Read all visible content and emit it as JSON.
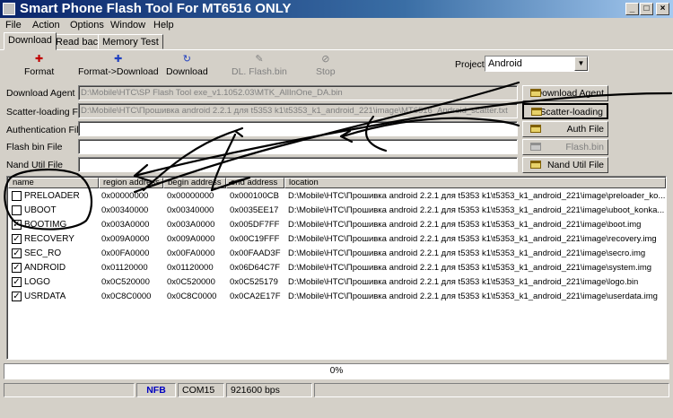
{
  "window": {
    "title": "Smart Phone Flash Tool For MT6516 ONLY",
    "minimize": "_",
    "maximize": "□",
    "close": "×"
  },
  "menu": [
    "File",
    "Action",
    "Options",
    "Window",
    "Help"
  ],
  "tabs": [
    "Download",
    "Read back",
    "Memory Test"
  ],
  "toolbar": {
    "format": "Format",
    "format_download": "Format->Download",
    "download": "Download",
    "dl_flash_bin": "DL. Flash.bin",
    "stop": "Stop"
  },
  "project": {
    "label": "Project",
    "value": "Android"
  },
  "fields": {
    "download_agent": {
      "label": "Download Agent",
      "value": "D:\\Mobile\\HTC\\SP Flash Tool exe_v1.1052.03\\MTK_AllInOne_DA.bin"
    },
    "scatter_loading": {
      "label": "Scatter-loading File",
      "value": "D:\\Mobile\\HTC\\Прошивка android 2.2.1 для t5353 k1\\t5353_k1_android_221\\image\\MT6516_Android_scatter.txt"
    },
    "authentication": {
      "label": "Authentication File",
      "value": ""
    },
    "flash_bin": {
      "label": "Flash bin File",
      "value": ""
    },
    "nand_util": {
      "label": "Nand Util File",
      "value": ""
    }
  },
  "buttons": {
    "download_agent": "Download Agent",
    "scatter_loading": "Scatter-loading",
    "auth_file": "Auth File",
    "flash_bin": "Flash.bin",
    "nand_util_file": "Nand Util File"
  },
  "list": {
    "headers": [
      "name",
      "region address",
      "begin address",
      "end address",
      "location"
    ],
    "rows": [
      {
        "checked": false,
        "name": "PRELOADER",
        "region": "0x00000000",
        "begin": "0x00000000",
        "end": "0x000100CB",
        "location": "D:\\Mobile\\HTC\\Прошивка android 2.2.1 для t5353 k1\\t5353_k1_android_221\\image\\preloader_ko..."
      },
      {
        "checked": false,
        "name": "UBOOT",
        "region": "0x00340000",
        "begin": "0x00340000",
        "end": "0x0035EE17",
        "location": "D:\\Mobile\\HTC\\Прошивка android 2.2.1 для t5353 k1\\t5353_k1_android_221\\image\\uboot_konka..."
      },
      {
        "checked": true,
        "name": "BOOTIMG",
        "region": "0x003A0000",
        "begin": "0x003A0000",
        "end": "0x005DF7FF",
        "location": "D:\\Mobile\\HTC\\Прошивка android 2.2.1 для t5353 k1\\t5353_k1_android_221\\image\\boot.img"
      },
      {
        "checked": true,
        "name": "RECOVERY",
        "region": "0x009A0000",
        "begin": "0x009A0000",
        "end": "0x00C19FFF",
        "location": "D:\\Mobile\\HTC\\Прошивка android 2.2.1 для t5353 k1\\t5353_k1_android_221\\image\\recovery.img"
      },
      {
        "checked": true,
        "name": "SEC_RO",
        "region": "0x00FA0000",
        "begin": "0x00FA0000",
        "end": "0x00FAAD3F",
        "location": "D:\\Mobile\\HTC\\Прошивка android 2.2.1 для t5353 k1\\t5353_k1_android_221\\image\\secro.img"
      },
      {
        "checked": true,
        "name": "ANDROID",
        "region": "0x01120000",
        "begin": "0x01120000",
        "end": "0x06D64C7F",
        "location": "D:\\Mobile\\HTC\\Прошивка android 2.2.1 для t5353 k1\\t5353_k1_android_221\\image\\system.img"
      },
      {
        "checked": true,
        "name": "LOGO",
        "region": "0x0C520000",
        "begin": "0x0C520000",
        "end": "0x0C525179",
        "location": "D:\\Mobile\\HTC\\Прошивка android 2.2.1 для t5353 k1\\t5353_k1_android_221\\image\\logo.bin"
      },
      {
        "checked": true,
        "name": "USRDATA",
        "region": "0x0C8C0000",
        "begin": "0x0C8C0000",
        "end": "0x0CA2E17F",
        "location": "D:\\Mobile\\HTC\\Прошивка android 2.2.1 для t5353 k1\\t5353_k1_android_221\\image\\userdata.img"
      }
    ]
  },
  "progress": {
    "text": "0%",
    "value": 0
  },
  "statusbar": {
    "type": "NFB",
    "port": "COM15",
    "baud": "921600 bps"
  },
  "colors": {
    "title_start": "#0a246a",
    "title_end": "#a6caf0",
    "face": "#d4d0c8",
    "annotation_ink": "#000000",
    "nfb_text": "#0000c0"
  }
}
